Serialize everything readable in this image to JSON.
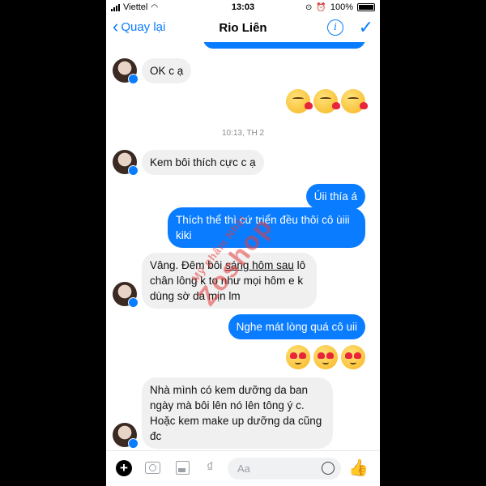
{
  "status": {
    "carrier": "Viettel",
    "time": "13:03",
    "battery": "100%"
  },
  "nav": {
    "back_label": "Quay lại",
    "title": "Rio Liên"
  },
  "messages": {
    "m1": "OK c ạ",
    "timestamp": "10:13, TH 2",
    "m2": "Kem bôi thích cực c ạ",
    "m3": "Úii thía á",
    "m4": "Thích thể thì cứ triển đều thôi cô ùiii kiki",
    "m5a": "Vâng. Đêm bôi ",
    "m5u": "sáng hôm sau",
    "m5b": " lô chân lông k to như mọi hôm e k dùng sờ da mịn lm",
    "m6": "Nghe mát lòng quá cô uii",
    "m7": "Nhà mình có kem dưỡng da ban ngày mà bôi lên nó lên tông ý c. Hoặc kem make up dưỡng da cũng đc"
  },
  "watermark": {
    "line1": "Mỹ phẩm Nhật",
    "line2": "Zoshop"
  },
  "composer": {
    "placeholder": "Aa"
  },
  "icons": [
    "wifi-icon",
    "signal-icon",
    "battery-icon",
    "info-icon",
    "check-icon",
    "plus-icon",
    "camera-icon",
    "image-icon",
    "money-icon",
    "smiley-icon",
    "like-icon"
  ],
  "colors": {
    "accent": "#0a7cff",
    "incoming": "#f0f0f0",
    "watermark": "#e63c3c"
  }
}
